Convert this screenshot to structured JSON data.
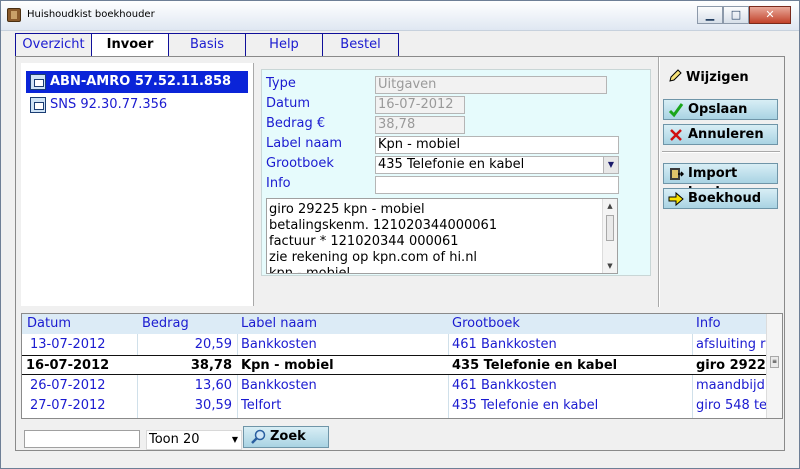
{
  "window": {
    "title": "Huishoudkist boekhouder"
  },
  "tabs": [
    {
      "label": "Overzicht",
      "active": false
    },
    {
      "label": "Invoer",
      "active": true
    },
    {
      "label": "Basis",
      "active": false
    },
    {
      "label": "Help",
      "active": false
    },
    {
      "label": "Bestel",
      "active": false
    }
  ],
  "accounts": [
    {
      "label": "ABN-AMRO 57.52.11.858",
      "selected": true
    },
    {
      "label": "SNS 92.30.77.356",
      "selected": false
    }
  ],
  "form": {
    "type_label": "Type",
    "type_value": "Uitgaven",
    "datum_label": "Datum",
    "datum_value": "16-07-2012",
    "bedrag_label": "Bedrag €",
    "bedrag_value": "38,78",
    "labelnaam_label": "Label naam",
    "labelnaam_value": "Kpn - mobiel",
    "grootboek_label": "Grootboek",
    "grootboek_value": "435 Telefonie en kabel",
    "info_label": "Info",
    "info_value": "",
    "memo_lines": [
      "giro 29225 kpn - mobiel",
      "betalingskenm. 121020344000061",
      "factuur * 121020344 000061",
      "zie rekening op kpn.com of hi.nl",
      "kpn - mobiel"
    ]
  },
  "actions": {
    "wijzigen": "Wijzigen",
    "opslaan": "Opslaan",
    "annuleren": "Annuleren",
    "import": "Import bank",
    "boekhoud": "Boekhoud"
  },
  "grid": {
    "headers": [
      "Datum",
      "Bedrag",
      "Label naam",
      "Grootboek",
      "Info"
    ],
    "rows": [
      {
        "datum": "13-07-2012",
        "bedrag": "20,59",
        "label": "Bankkosten",
        "grootboek": "461 Bankkosten",
        "info": "afsluiting r",
        "selected": false
      },
      {
        "datum": "16-07-2012",
        "bedrag": "38,78",
        "label": "Kpn - mobiel",
        "grootboek": "435 Telefonie en kabel",
        "info": "giro 2922",
        "selected": true
      },
      {
        "datum": "26-07-2012",
        "bedrag": "13,60",
        "label": "Bankkosten",
        "grootboek": "461 Bankkosten",
        "info": "maandbijd",
        "selected": false
      },
      {
        "datum": "27-07-2012",
        "bedrag": "30,59",
        "label": "Telfort",
        "grootboek": "435 Telefonie en kabel",
        "info": "giro 548 te",
        "selected": false
      }
    ]
  },
  "bottom": {
    "search_value": "",
    "toon_value": "Toon 20",
    "zoek_label": "Zoek"
  },
  "colors": {
    "tab_border": "#10109a",
    "link_blue": "#1b1bd0",
    "selection": "#0a24d8",
    "detail_bg": "#e6fbfc",
    "button_bg": "#a9d3e3"
  }
}
